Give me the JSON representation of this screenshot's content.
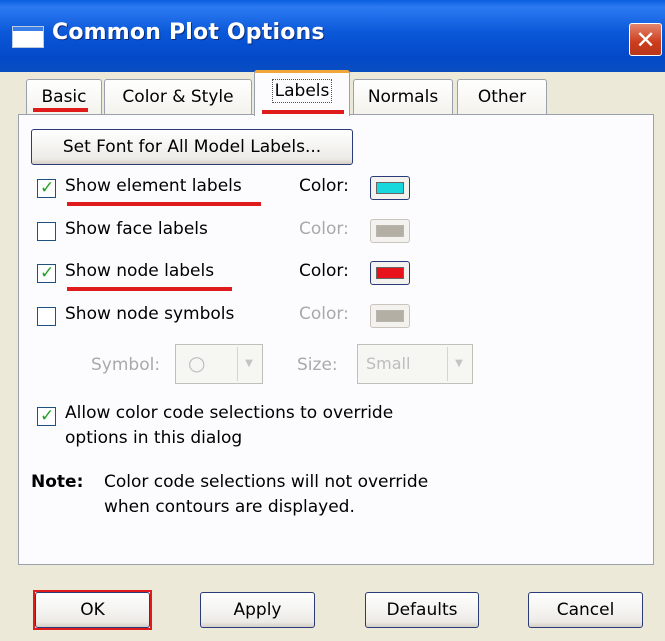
{
  "window": {
    "title": "Common Plot Options",
    "close_glyph": "✕"
  },
  "tabs": [
    {
      "label": "Basic"
    },
    {
      "label": "Color & Style"
    },
    {
      "label": "Labels",
      "active": true
    },
    {
      "label": "Normals"
    },
    {
      "label": "Other"
    }
  ],
  "labels_tab": {
    "set_font_button": "Set Font for All Model Labels...",
    "color_label": "Color:",
    "rows": [
      {
        "label": "Show element labels",
        "checked": true,
        "color": "#19d8dd",
        "enabled": true
      },
      {
        "label": "Show face labels",
        "checked": false,
        "color": "#b3afa4",
        "enabled": false
      },
      {
        "label": "Show node labels",
        "checked": true,
        "color": "#e8121a",
        "enabled": true
      },
      {
        "label": "Show node symbols",
        "checked": false,
        "color": "#b3afa4",
        "enabled": false
      }
    ],
    "symbol_label": "Symbol:",
    "symbol_glyph": "○",
    "size_label": "Size:",
    "size_value": "Small",
    "override_line1": "Allow color code selections to override",
    "override_line2": "options in this dialog",
    "override_checked": true,
    "note_label": "Note:",
    "note_line1": "Color code selections will not override",
    "note_line2": "when contours are displayed."
  },
  "buttons": {
    "ok": "OK",
    "apply": "Apply",
    "defaults": "Defaults",
    "cancel": "Cancel"
  },
  "colors": {
    "annotation_red": "#e01b1b",
    "title_blue": "#0a58d8",
    "dialog_bg": "#ece9d8",
    "check_green": "#21a121"
  }
}
